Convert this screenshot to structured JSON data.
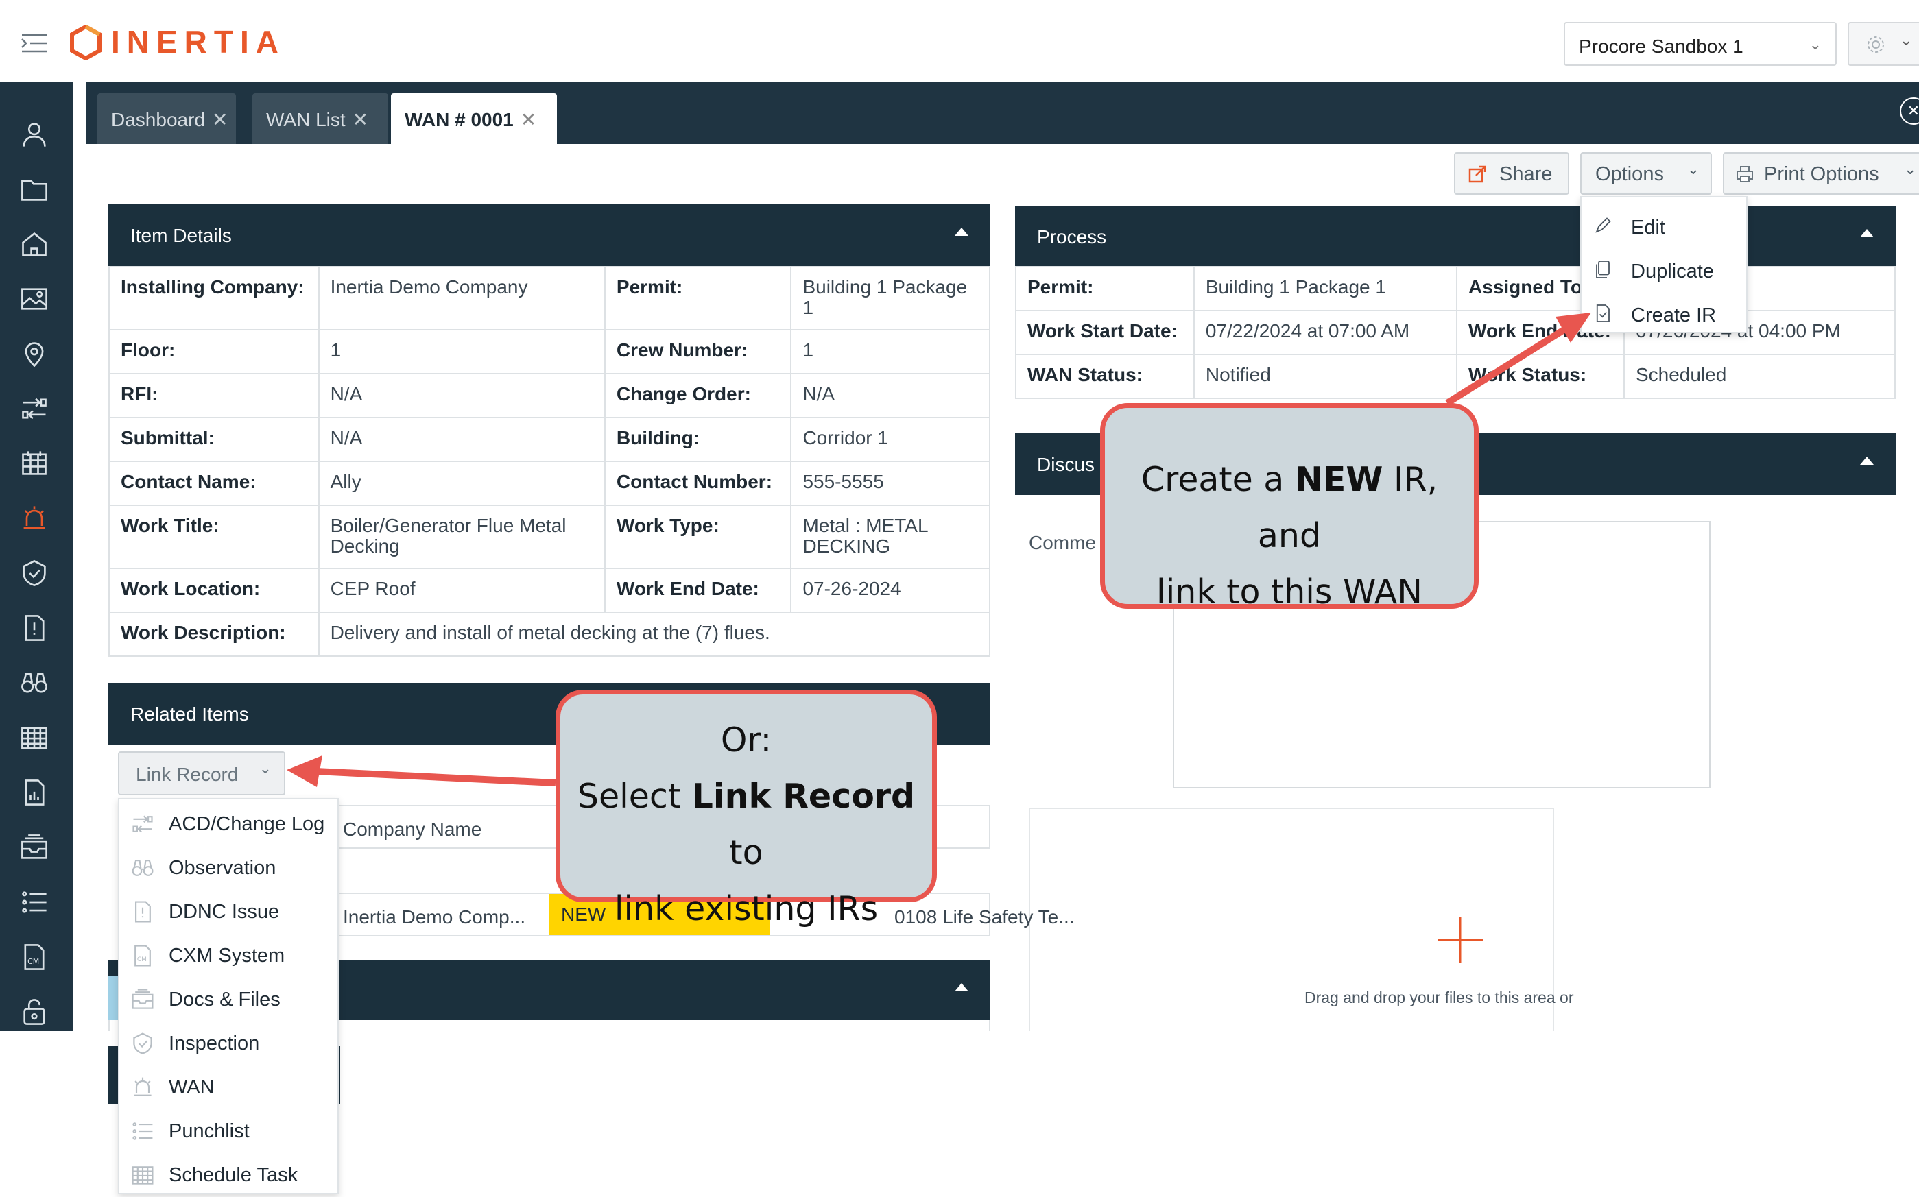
{
  "app": {
    "logo": "INERTIA",
    "project": "Procore Sandbox 1"
  },
  "sidebar": {
    "icons": [
      "user-icon",
      "folder-icon",
      "home-icon",
      "image-icon",
      "location-icon",
      "transfer-icon",
      "calendar-grid-icon",
      "alarm-icon",
      "shield-check-icon",
      "issue-icon",
      "binoculars-icon",
      "schedule-icon",
      "report-icon",
      "inbox-icon",
      "list-icon",
      "cm-icon",
      "lock-icon"
    ],
    "active_index": 7,
    "active_color": "#e8582a"
  },
  "tabs": [
    {
      "label": "Dashboard"
    },
    {
      "label": "WAN List"
    },
    {
      "label": "WAN # 0001"
    }
  ],
  "tab_close": "✕",
  "actions": {
    "share": "Share",
    "options": "Options",
    "print_options": "Print Options"
  },
  "options_menu": [
    "Edit",
    "Duplicate",
    "Create IR"
  ],
  "item_details": {
    "title": "Item Details",
    "rows": [
      [
        "Installing Company:",
        "Inertia Demo Company",
        "Permit:",
        "Building 1 Package 1"
      ],
      [
        "Floor:",
        "1",
        "Crew Number:",
        "1"
      ],
      [
        "RFI:",
        "N/A",
        "Change Order:",
        "N/A"
      ],
      [
        "Submittal:",
        "N/A",
        "Building:",
        "Corridor 1"
      ],
      [
        "Contact Name:",
        "Ally",
        "Contact Number:",
        "555-5555"
      ],
      [
        "Work Title:",
        "Boiler/Generator Flue Metal Decking",
        "Work Type:",
        "Metal : METAL DECKING"
      ],
      [
        "Work Location:",
        "CEP Roof",
        "Work End Date:",
        "07-26-2024"
      ]
    ],
    "description_label": "Work Description:",
    "description": "Delivery and install of metal decking at the (7) flues."
  },
  "process": {
    "title": "Process",
    "rows": [
      [
        "Permit:",
        "Building 1 Package 1",
        "Assigned To",
        ""
      ],
      [
        "Work Start Date:",
        "07/22/2024 at 07:00 AM",
        "Work End Date:",
        "07/26/2024 at 04:00 PM"
      ],
      [
        "WAN Status:",
        "Notified",
        "Work Status:",
        "Scheduled"
      ]
    ]
  },
  "discussion": {
    "title": "Discus",
    "comments_label": "Comme"
  },
  "dropzone": {
    "text": "Drag and drop your files to this area or"
  },
  "related_items": {
    "title": "Related Items",
    "link_record": "Link Record",
    "column_company": "Company Name",
    "row": {
      "company": "Inertia Demo Comp...",
      "status": "NEW",
      "title": "0108 Life Safety Te..."
    },
    "status_color": "#ffd400"
  },
  "link_menu": [
    {
      "label": "ACD/Change Log",
      "icon": "transfer-icon"
    },
    {
      "label": "Observation",
      "icon": "binoculars-icon"
    },
    {
      "label": "DDNC Issue",
      "icon": "issue-icon"
    },
    {
      "label": "CXM System",
      "icon": "cm-icon"
    },
    {
      "label": "Docs & Files",
      "icon": "inbox-icon"
    },
    {
      "label": "Inspection",
      "icon": "shield-check-icon"
    },
    {
      "label": "WAN",
      "icon": "alarm-icon"
    },
    {
      "label": "Punchlist",
      "icon": "list-icon"
    },
    {
      "label": "Schedule Task",
      "icon": "schedule-icon"
    }
  ],
  "callouts": {
    "create_ir": {
      "line1_pre": "Create a ",
      "line1_bold": "NEW",
      "line1_post": " IR, and",
      "line2": "link to this WAN"
    },
    "link_record": {
      "line1": "Or:",
      "line2_pre": "Select ",
      "line2_bold": "Link Record",
      "line2_post": " to",
      "line3": "link existing IRs"
    }
  },
  "colors": {
    "navy": "#1b303d",
    "accent": "#e8582a",
    "arrow": "#e8564f",
    "callout_bg": "#cdd7dc"
  }
}
